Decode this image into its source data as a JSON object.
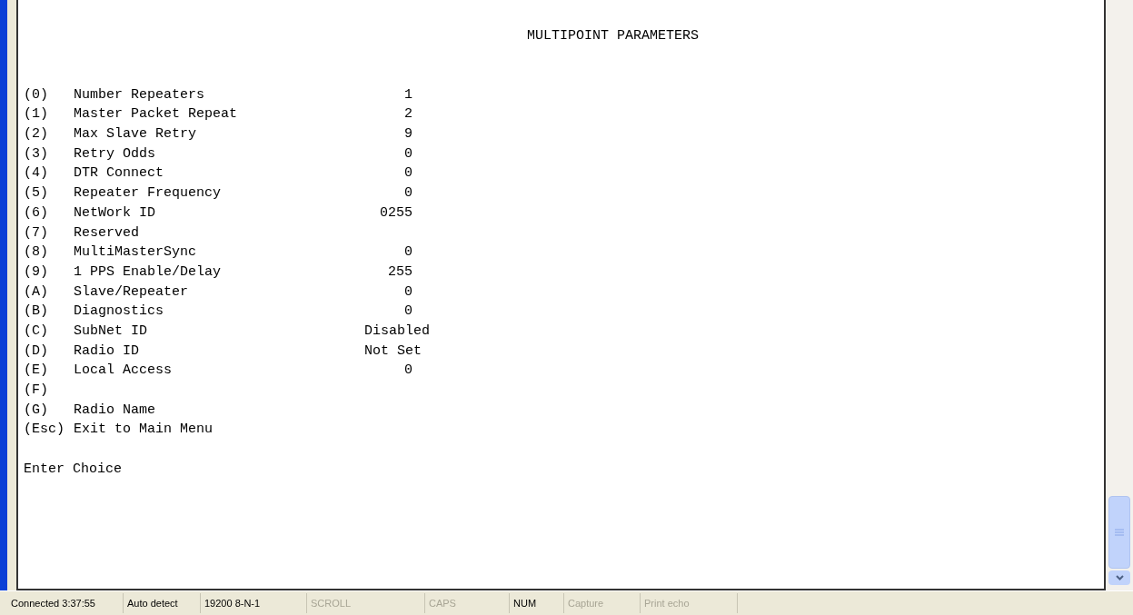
{
  "terminal": {
    "title": "MULTIPOINT PARAMETERS",
    "options": [
      {
        "key": "(0)",
        "label": "Number Repeaters",
        "value": "1"
      },
      {
        "key": "(1)",
        "label": "Master Packet Repeat",
        "value": "2"
      },
      {
        "key": "(2)",
        "label": "Max Slave Retry",
        "value": "9"
      },
      {
        "key": "(3)",
        "label": "Retry Odds",
        "value": "0"
      },
      {
        "key": "(4)",
        "label": "DTR Connect",
        "value": "0"
      },
      {
        "key": "(5)",
        "label": "Repeater Frequency",
        "value": "0"
      },
      {
        "key": "(6)",
        "label": "NetWork ID",
        "value": "0255"
      },
      {
        "key": "(7)",
        "label": "Reserved"
      },
      {
        "key": "(8)",
        "label": "MultiMasterSync",
        "value": "0"
      },
      {
        "key": "(9)",
        "label": "1 PPS Enable/Delay",
        "value": "255"
      },
      {
        "key": "(A)",
        "label": "Slave/Repeater",
        "value": "0"
      },
      {
        "key": "(B)",
        "label": "Diagnostics",
        "value": "0"
      },
      {
        "key": "(C)",
        "label": "SubNet ID",
        "value": "Disabled"
      },
      {
        "key": "(D)",
        "label": "Radio ID",
        "value": "Not Set"
      },
      {
        "key": "(E)",
        "label": "Local Access",
        "value": "0"
      },
      {
        "key": "(F)"
      },
      {
        "key": "(G)",
        "label": "Radio Name"
      }
    ],
    "exit": {
      "key": "(Esc)",
      "label": "Exit to Main Menu"
    },
    "prompt": "Enter Choice"
  },
  "status_bar": [
    {
      "text": "Connected 3:37:55",
      "on": true
    },
    {
      "text": "Auto detect",
      "on": true
    },
    {
      "text": "19200 8-N-1",
      "on": true
    },
    {
      "text": "SCROLL",
      "on": false
    },
    {
      "text": "CAPS",
      "on": false
    },
    {
      "text": "NUM",
      "on": true
    },
    {
      "text": "Capture",
      "on": false
    },
    {
      "text": "Print echo",
      "on": false
    }
  ]
}
